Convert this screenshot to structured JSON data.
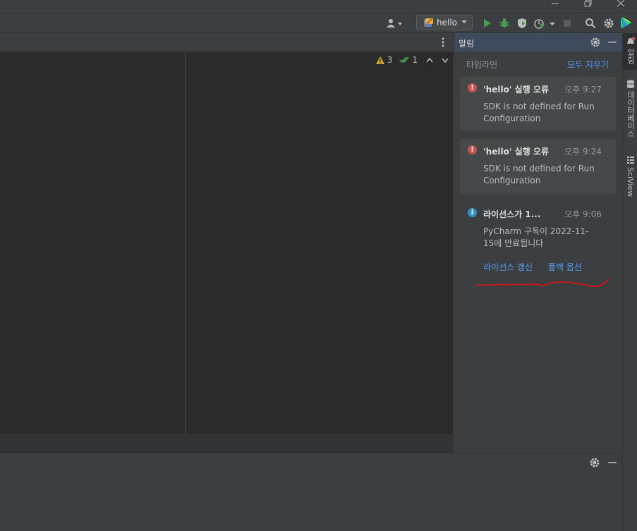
{
  "toolbar": {
    "run_config_label": "hello"
  },
  "editor": {
    "inspection": {
      "warnings": "3",
      "checks": "1"
    }
  },
  "notifications": {
    "title": "알림",
    "tab_label": "타임라인",
    "clear_all_label": "모두 지우기",
    "items": [
      {
        "type": "error",
        "title": "'hello' 실행 오류",
        "time": "오후 9:27",
        "body": "SDK is not defined for Run Configuration"
      },
      {
        "type": "error",
        "title": "'hello' 실행 오류",
        "time": "오후 9:24",
        "body": "SDK is not defined for Run Configuration"
      },
      {
        "type": "info",
        "title": "라이선스가 1...",
        "time": "오후 9:06",
        "body": "PyCharm 구독이 2022-11-15에 만료됩니다",
        "actions": [
          "라이선스 갱신",
          "폴백 옵션"
        ]
      }
    ]
  },
  "right_stripe": {
    "tabs": [
      "알림",
      "데이터베이스",
      "SciView"
    ]
  },
  "icons": {
    "error_color": "#c75450",
    "info_color": "#3592c4",
    "run_color": "#499c54",
    "accent_link": "#589df6"
  }
}
